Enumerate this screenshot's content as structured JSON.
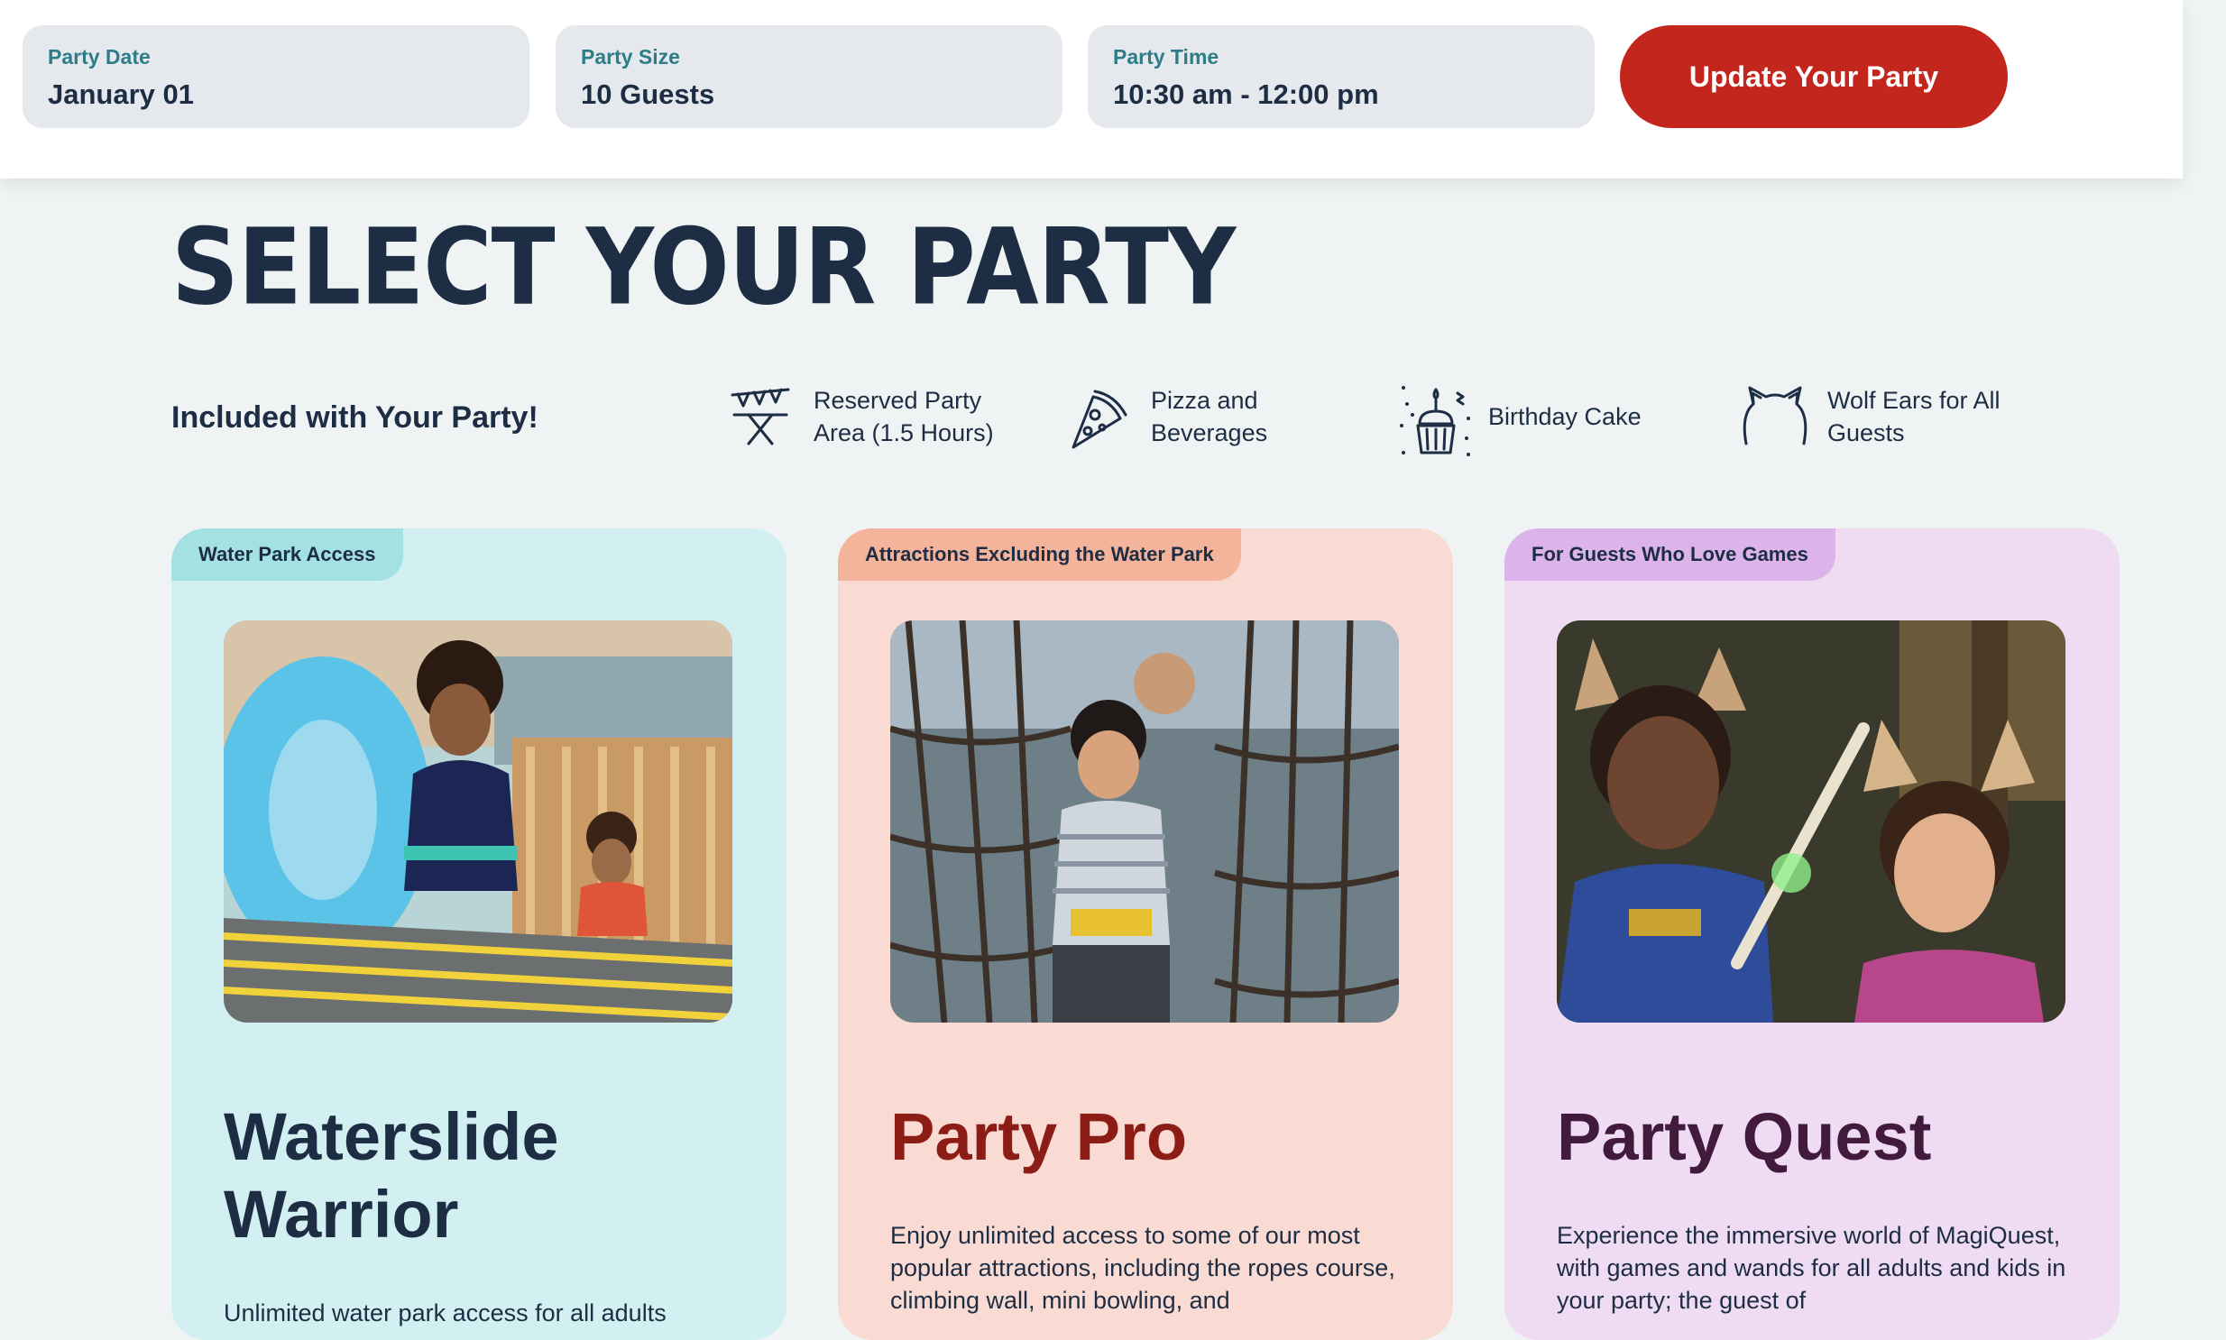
{
  "booking_bar": {
    "party_date": {
      "label": "Party Date",
      "value": "January 01"
    },
    "party_size": {
      "label": "Party Size",
      "value": "10 Guests"
    },
    "party_time": {
      "label": "Party Time",
      "value": "10:30 am - 12:00 pm"
    },
    "update_button": "Update Your Party"
  },
  "page_title": "SELECT YOUR PARTY",
  "included": {
    "title": "Included with Your Party!",
    "items": [
      {
        "icon": "party-table-icon",
        "line1": "Reserved Party",
        "line2": "Area (1.5 Hours)"
      },
      {
        "icon": "pizza-icon",
        "line1": "Pizza and",
        "line2": "Beverages"
      },
      {
        "icon": "birthday-cake-icon",
        "line1": "Birthday Cake"
      },
      {
        "icon": "wolf-ears-icon",
        "line1": "Wolf Ears for All",
        "line2": "Guests"
      }
    ]
  },
  "cards": [
    {
      "tag": "Water Park Access",
      "title_line1": "Waterslide",
      "title_line2": "Warrior",
      "description": "Unlimited water park access for all adults"
    },
    {
      "tag": "Attractions Excluding the Water Park",
      "title": "Party Pro",
      "description": "Enjoy unlimited access to some of our most popular attractions, including the ropes course, climbing wall, mini bowling, and"
    },
    {
      "tag": "For Guests Who Love Games",
      "title": "Party Quest",
      "description": "Experience the immersive world of MagiQuest, with games and wands for all adults and kids in your party; the guest of"
    }
  ],
  "colors": {
    "accent_red": "#c2261c",
    "navy": "#1d2d44",
    "teal_label": "#2d7d86",
    "card1_bg": "#d2f0f1",
    "card2_bg": "#f9dbd3",
    "card3_bg": "#efdcf3"
  }
}
